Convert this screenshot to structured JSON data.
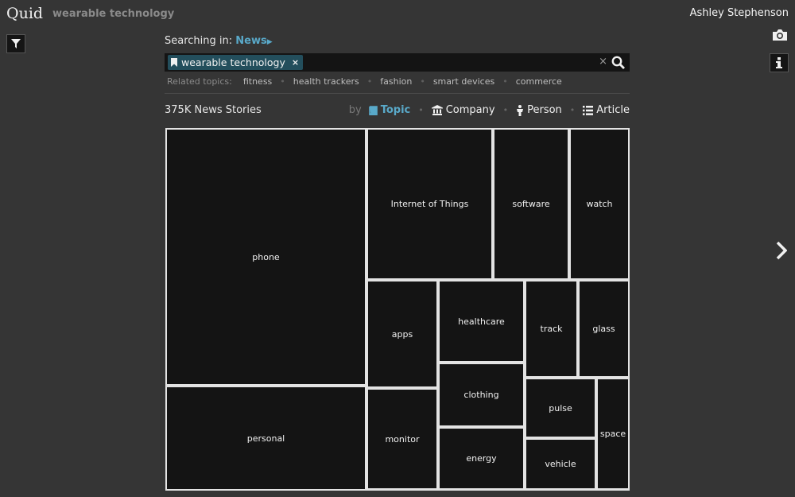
{
  "header": {
    "logo": "Quid",
    "app_title": "wearable technology",
    "user_name": "Ashley Stephenson"
  },
  "icons": {
    "filter": "filter-icon",
    "camera": "camera-icon",
    "info": "info-icon",
    "next": "chevron-right-icon",
    "search": "search-icon",
    "clear": "close-icon",
    "bookmark": "bookmark-icon"
  },
  "search": {
    "searching_label": "Searching in:",
    "source": "News",
    "query_chip": "wearable technology",
    "chip_remove": "×",
    "clear": "×"
  },
  "related": {
    "label": "Related topics:",
    "topics": [
      "fitness",
      "health trackers",
      "fashion",
      "smart devices",
      "commerce"
    ],
    "separator": "•"
  },
  "results": {
    "count": "375K News Stories",
    "by_label": "by",
    "options": [
      {
        "label": "Topic",
        "icon": "book-icon",
        "active": true
      },
      {
        "label": "Company",
        "icon": "bank-icon",
        "active": false
      },
      {
        "label": "Person",
        "icon": "person-icon",
        "active": false
      },
      {
        "label": "Article",
        "icon": "list-icon",
        "active": false
      }
    ]
  },
  "colors": {
    "accent": "#59a9c9",
    "chip_bg": "#234e5c",
    "background": "#353535",
    "cell_bg": "#141414"
  },
  "treemap": {
    "cells": [
      {
        "label": "phone"
      },
      {
        "label": "personal"
      },
      {
        "label": "Internet of Things"
      },
      {
        "label": "software"
      },
      {
        "label": "watch"
      },
      {
        "label": "apps"
      },
      {
        "label": "monitor"
      },
      {
        "label": "healthcare"
      },
      {
        "label": "clothing"
      },
      {
        "label": "energy"
      },
      {
        "label": "track"
      },
      {
        "label": "glass"
      },
      {
        "label": "pulse"
      },
      {
        "label": "vehicle"
      },
      {
        "label": "space"
      }
    ]
  }
}
